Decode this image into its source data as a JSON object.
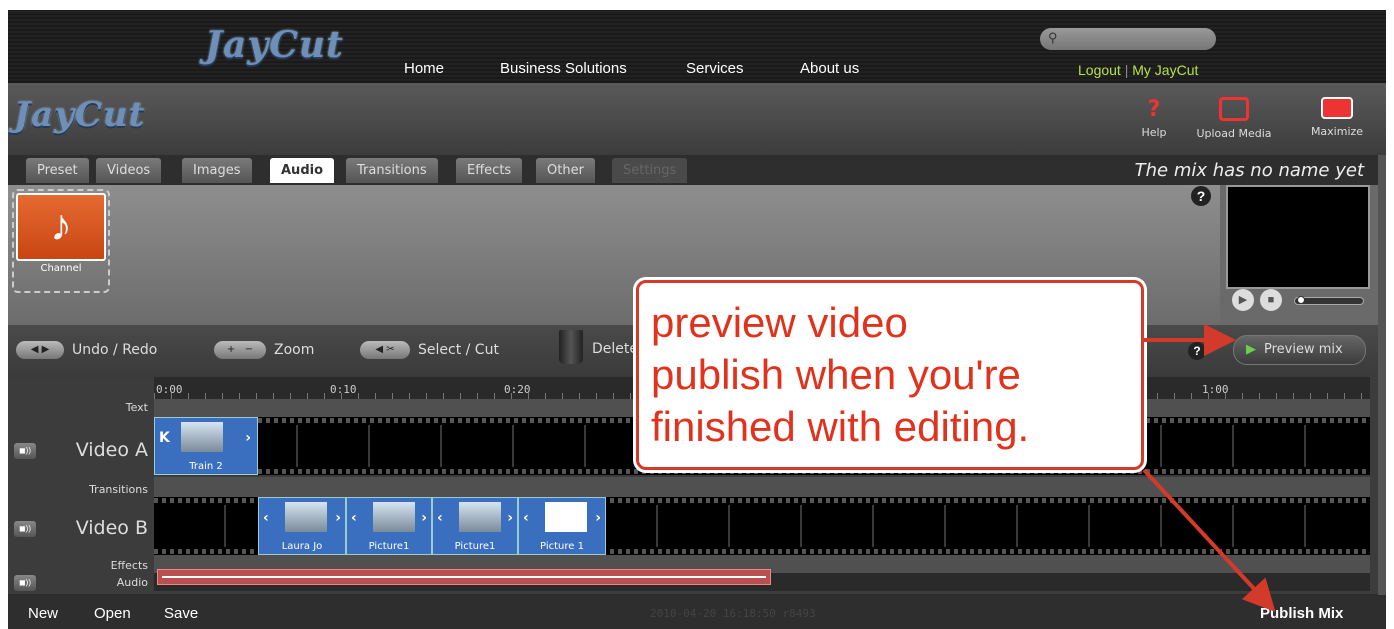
{
  "site": {
    "logo": "JayCut",
    "nav": [
      "Home",
      "Business Solutions",
      "Services",
      "About us"
    ],
    "search": {
      "icon": "search-icon",
      "placeholder": ""
    },
    "account": {
      "logout": "Logout",
      "separator": "|",
      "my": "My JayCut"
    }
  },
  "editor": {
    "logo": "JayCut",
    "tools": {
      "help": "Help",
      "upload": "Upload Media",
      "maximize": "Maximize"
    },
    "tabs": [
      "Preset",
      "Videos",
      "Images",
      "Audio",
      "Transitions",
      "Effects",
      "Other",
      "Settings"
    ],
    "active_tab": "Audio",
    "mix_name": "The mix has no name yet",
    "media": [
      {
        "label": "Channel",
        "icon": "music-note-icon"
      }
    ],
    "toolbar": {
      "undo_redo": "Undo / Redo",
      "zoom": "Zoom",
      "select_cut": "Select / Cut",
      "delete": "Delete",
      "preview": "Preview mix"
    },
    "timeline": {
      "ticks": [
        "0:00",
        "0:10",
        "0:20",
        "1:00"
      ],
      "lanes": {
        "text": "Text",
        "video_a": "Video A",
        "transitions": "Transitions",
        "video_b": "Video B",
        "effects": "Effects",
        "audio": "Audio"
      },
      "video_a_clips": [
        "Train 2"
      ],
      "video_b_clips": [
        "Laura Jo",
        "Picture1",
        "Picture1",
        "Picture 1"
      ]
    },
    "status": {
      "new": "New",
      "open": "Open",
      "save": "Save",
      "stamp": "2010-04-20 16:18:50 r8493",
      "publish": "Publish Mix"
    }
  },
  "annotation": {
    "lines": [
      "preview video",
      "publish when you're",
      "finished with editing."
    ],
    "color": "#e0321c"
  }
}
